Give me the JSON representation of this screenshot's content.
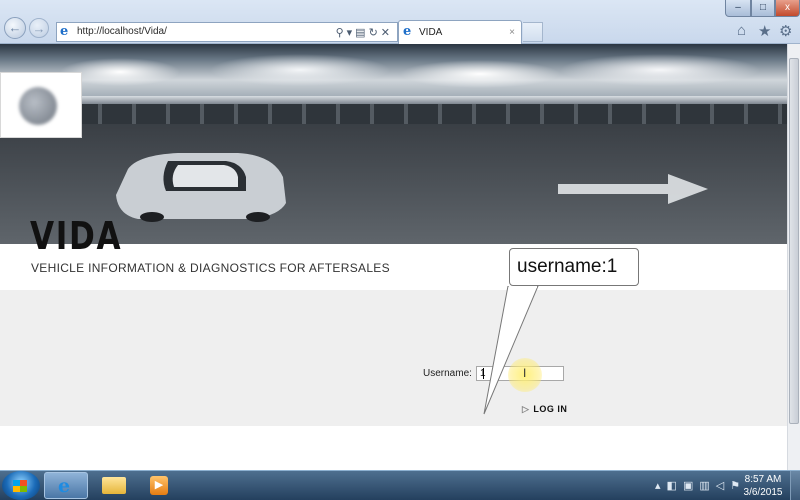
{
  "browser": {
    "address_url": "http://localhost/Vida/",
    "tab_title": "VIDA",
    "tab_close": "×",
    "back_glyph": "←",
    "forward_glyph": "→",
    "window_min": "–",
    "window_max": "□",
    "window_close": "x",
    "icons": [
      "back-icon",
      "forward-icon",
      "ie-icon",
      "search-icon",
      "dropdown-icon",
      "compat-view-icon",
      "refresh-icon",
      "stop-icon",
      "home-icon",
      "favorites-icon",
      "tools-icon"
    ]
  },
  "page": {
    "brand_title": "VIDA",
    "tagline": "VEHICLE INFORMATION & DIAGNOSTICS FOR AFTERSALES",
    "login": {
      "username_label": "Username:",
      "username_value": "1",
      "login_button": "LOG IN"
    },
    "callout_text": "username:1"
  },
  "taskbar": {
    "clock_time": "8:57 AM",
    "clock_date": "3/6/2015",
    "pinned": [
      "internet-explorer",
      "windows-explorer",
      "media-player"
    ]
  }
}
